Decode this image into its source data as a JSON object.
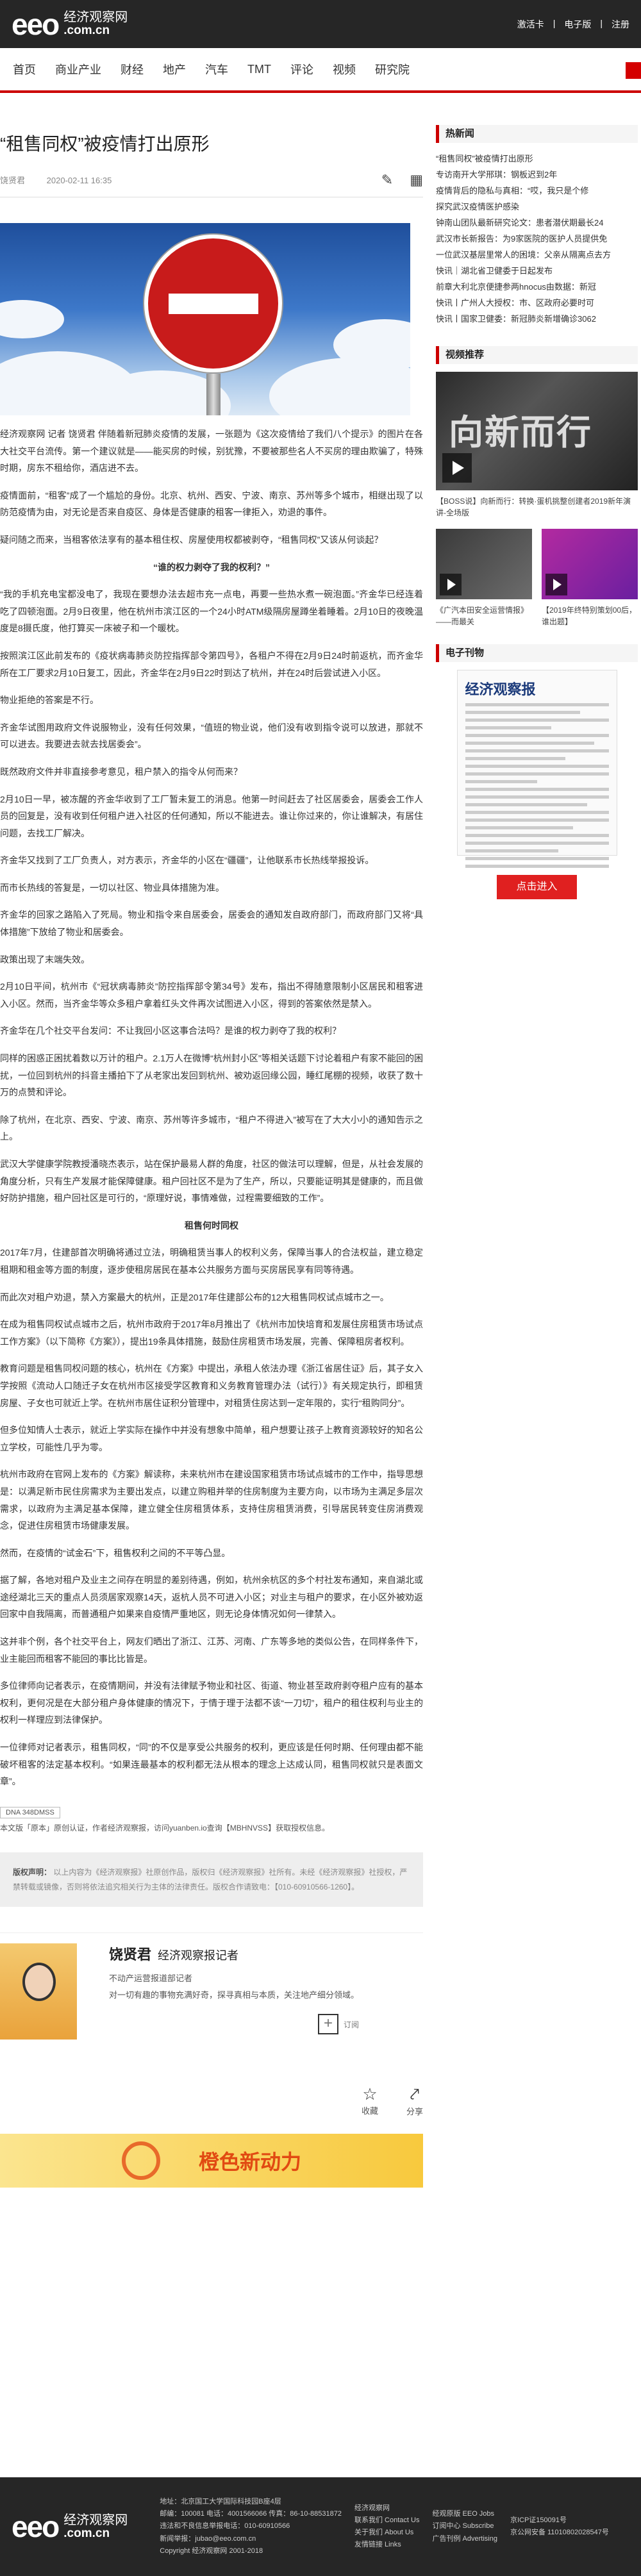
{
  "header": {
    "logo_mark": "eeo",
    "logo_cn": "经济观察网",
    "logo_domain": ".com.cn",
    "links": [
      "激活卡",
      "电子版",
      "注册"
    ]
  },
  "nav": [
    "首页",
    "商业产业",
    "财经",
    "地产",
    "汽车",
    "TMT",
    "评论",
    "视频",
    "研究院"
  ],
  "article": {
    "title": "“租售同权”被疫情打出原形",
    "author": "饶贤君",
    "date": "2020-02-11 16:35",
    "paragraphs": [
      {
        "text": "经济观察网 记者 饶贤君 伴随着新冠肺炎疫情的发展，一张题为《这次疫情给了我们八个提示》的图片在各大社交平台流传。第一个建议就是——能买房的时候，别犹豫，不要被那些名人不买房的理由欺骗了，特殊时期，房东不租给你，酒店进不去。",
        "style": "strong"
      },
      {
        "text": "疫情面前，“租客”成了一个尴尬的身份。北京、杭州、西安、宁波、南京、苏州等多个城市，相继出现了以防范疫情为由，对无论是否来自疫区、身体是否健康的租客一律拒入，劝退的事件。"
      },
      {
        "text": "疑问随之而来，当租客依法享有的基本租住权、房屋使用权都被剥夺，“租售同权”又该从何谈起？"
      },
      {
        "text": "“谁的权力剥夺了我的权利？”",
        "style": "center"
      },
      {
        "text": "“我的手机充电宝都没电了，我现在要想办法去超市充一点电，再要一些热水煮一碗泡面。”齐金华已经连着吃了四顿泡面。2月9日夜里，他在杭州市滨江区的一个24小时ATM级隔房屋蹲坐着睡着。2月10日的夜晚温度是8摄氏度，他打算买一床被子和一个暖枕。"
      },
      {
        "text": "按照滨江区此前发布的《疫状病毒肺炎防控指挥部令第四号》，各租户不得在2月9日24时前返杭，而齐金华所在工厂要求2月10日复工，因此，齐金华在2月9日22时到达了杭州，并在24时后尝试进入小区。"
      },
      {
        "text": "物业拒绝的答案是不行。"
      },
      {
        "text": "齐金华试图用政府文件说服物业，没有任何效果，“值班的物业说，他们没有收到指令说可以放进，那就不可以进去。我要进去就去找居委会”。"
      },
      {
        "text": "既然政府文件并非直接参考意见，租户禁入的指令从何而来？"
      },
      {
        "text": "2月10日一早，被冻醒的齐金华收到了工厂暂未复工的消息。他第一时间赶去了社区居委会，居委会工作人员的回复是，没有收到任何租户进入社区的任何通知，所以不能进去。谁让你过来的，你让谁解决，有居住问题，去找工厂解决。"
      },
      {
        "text": "齐金华又找到了工厂负责人，对方表示，齐金华的小区在“疆疆”，让他联系市长热线举报投诉。"
      },
      {
        "text": "而市长热线的答复是，一切以社区、物业具体措施为准。"
      },
      {
        "text": "齐金华的回家之路陷入了死局。物业和指令来自居委会，居委会的通知发自政府部门，而政府部门又将“具体措施”下放给了物业和居委会。"
      },
      {
        "text": "政策出现了末端失效。"
      },
      {
        "text": "2月10日平间，杭州市《“冠状病毒肺炎”防控指挥部令第34号》发布，指出不得随意限制小区居民和租客进入小区。然而，当齐金华等众多租户拿着红头文件再次试图进入小区，得到的答案依然是禁入。"
      },
      {
        "text": "齐金华在几个社交平台发问：不让我回小区这事合法吗？是谁的权力剥夺了我的权利？"
      },
      {
        "text": "同样的困惑正困扰着数以万计的租户。2.1万人在微博“杭州封小区”等相关话题下讨论着租户有家不能回的困扰，一位回到杭州的抖音主播拍下了从老家出发回到杭州、被劝返回缘公园，睡红尾棚的视频，收获了数十万的点赞和评论。"
      },
      {
        "text": "除了杭州，在北京、西安、宁波、南京、苏州等许多城市，“租户不得进入”被写在了大大小小的通知告示之上。"
      },
      {
        "text": "武汉大学健康学院教授潘晓杰表示，站在保护最易人群的角度，社区的做法可以理解，但是，从社会发展的角度分析，只有生产发展才能保障健康。租户回社区不是为了生产，所以，只要能证明其是健康的，而且做好防护措施，租户回社区是可行的，“原理好说，事情难做，过程需要细致的工作”。"
      },
      {
        "text": "租售何时同权",
        "style": "center"
      },
      {
        "text": "2017年7月，住建部首次明确将通过立法，明确租赁当事人的权利义务，保障当事人的合法权益，建立稳定租期和租金等方面的制度，逐步使租房居民在基本公共服务方面与买房居民享有同等待遇。"
      },
      {
        "text": "而此次对租户劝退，禁入方案最大的杭州，正是2017年住建部公布的12大租售同权试点城市之一。"
      },
      {
        "text": "在成为租售同权试点城市之后，杭州市政府于2017年8月推出了《杭州市加快培育和发展住房租赁市场试点工作方案》（以下简称《方案》），提出19条具体措施，鼓励住房租赁市场发展，完善、保障租房者权利。"
      },
      {
        "text": "教育问题是租售同权问题的核心，杭州在《方案》中提出，承租人依法办理《浙江省居住证》后，其子女入学按照《流动人口随迁子女在杭州市区接受学区教育和义务教育管理办法（试行）》有关规定执行，即租赁房屋、子女也可就近上学。在杭州市居住证积分管理中，对租赁住房达到一定年限的，实行“租购同分”。"
      },
      {
        "text": "但多位知情人士表示，就近上学实际在操作中并没有想象中简单，租户想要让孩子上教育资源较好的知名公立学校，可能性几乎为零。"
      },
      {
        "text": "杭州市政府在官网上发布的《方案》解读称，未来杭州市在建设国家租赁市场试点城市的工作中，指导思想是：以满足新市民住房需求为主要出发点，以建立购租并举的住房制度为主要方向，以市场为主满足多层次需求，以政府为主满足基本保障，建立健全住房租赁体系，支持住房租赁消费，引导居民转变住房消费观念，促进住房租赁市场健康发展。"
      },
      {
        "text": "然而，在疫情的“试金石”下，租售权利之间的不平等凸显。"
      },
      {
        "text": "据了解，各地对租户及业主之间存在明显的差别待遇，例如，杭州余杭区的多个村社发布通知，来自湖北或途经湖北三天的重点人员须居家观察14天，返杭人员不可进入小区；对业主与租户的要求，在小区外被劝返回家中自我隔离，而普通租户如果来自疫情严重地区，则无论身体情况如何一律禁入。"
      },
      {
        "text": "这并非个例，各个社交平台上，网友们晒出了浙江、江苏、河南、广东等多地的类似公告，在同样条件下，业主能回而租客不能回的事比比皆是。"
      },
      {
        "text": "多位律师向记者表示，在疫情期间，并没有法律赋予物业和社区、街道、物业甚至政府剥夺租户应有的基本权利，更何况是在大部分租户身体健康的情况下，于情于理于法都不该“一刀切”，租户的租住权利与业主的权利一样理应到法律保护。"
      },
      {
        "text": "一位律师对记者表示，租售同权，“同”的不仅是享受公共服务的权利，更应该是任何时期、任何理由都不能破坏租客的法定基本权利。“如果连最基本的权利都无法从根本的理念上达成认同，租售同权就只是表面文章”。"
      }
    ],
    "dna": "DNA 348DMSS",
    "source": "本文版「原本」原创认证，作者经济观察报，访问yuanben.io查询【MBHNVSS】获取授权信息。",
    "copyright_label": "版权声明：",
    "copyright_text": "以上内容为《经济观察报》社原创作品，版权归《经济观察报》社所有。未经《经济观察报》社授权，严禁转载或镜像，否则将依法追究相关行为主体的法律责任。版权合作请致电：【010-60910566-1260】。"
  },
  "author_card": {
    "name": "饶贤君",
    "title": "经济观察报记者",
    "role": "不动产运营报道部记者",
    "bio": "对一切有趣的事物充满好奇，探寻真相与本质，关注地产细分领域。",
    "follow": "订阅"
  },
  "actions": {
    "collect": "收藏",
    "share": "分享"
  },
  "banner": {
    "text": "橙色新动力"
  },
  "sidebar": {
    "hot_title": "热新闻",
    "hot_items": [
      "“租售同权”被疫情打出原形",
      "专访南开大学邢琪：钢板迟到2年",
      "疫情背后的隐私与真相：“哎，我只是个修",
      "探究武汉疫情医护感染",
      "钟南山团队最新研究论文：患者潜伏期最长24",
      "武汉市长新报告：为9家医院的医护人员提供免",
      "一位武汉基层里常人的困境：父亲从隔离点去方",
      "快讯｜湖北省卫健委于日起发布",
      "前章大利北京便捷参两hnocus由数据：新冠",
      "快讯丨广州人大授权：市、区政府必要时可",
      "快讯丨国家卫健委：新冠肺炎新增确诊3062"
    ],
    "video_title": "视频推荐",
    "video_big_caption": "【BOSS说】向新而行：转换·蛋机挑整创建者2019新年演讲-全场版",
    "video_small": [
      {
        "caption": "《广汽本田安全运营情报》——而最关"
      },
      {
        "caption": "【2019年终特别策划00后，谁出题】"
      }
    ],
    "paper_title": "电子刊物",
    "paper_name": "经济观察报",
    "enter_button": "点击进入"
  },
  "footer": {
    "logo_cn": "经济观察网",
    "logo_domain": ".com.cn",
    "col1": [
      "地址：北京国工大学国际科技园B座4层",
      "邮编：100081 电话：4001566066 传真：86-10-88531872",
      "违法和不良信息举报电话：010-60910566",
      "新闻举报：jubao@eeo.com.cn",
      "Copyright 经济观察网 2001-2018"
    ],
    "col2": [
      "经济观察网",
      "联系我们 Contact Us",
      "关于我们 About Us",
      "友情链接 Links"
    ],
    "col3": [
      "经观原版 EEO Jobs",
      "订阅中心 Subscribe",
      "广告刊例 Advertising"
    ],
    "col4": [
      "京ICP证150091号",
      "京公网安备 11010802028547号"
    ]
  }
}
